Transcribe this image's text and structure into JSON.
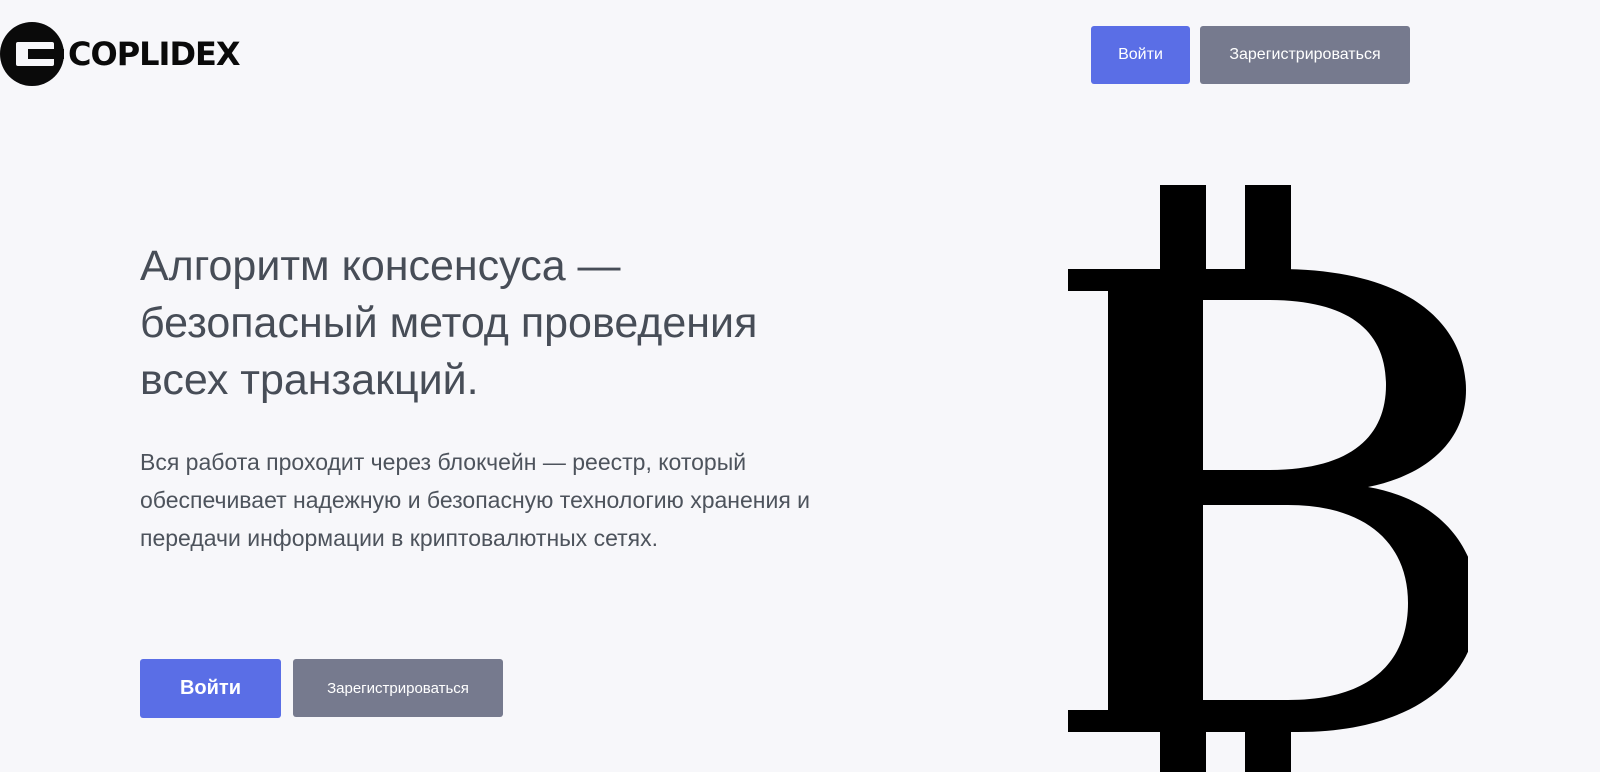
{
  "brand": {
    "name": "COPLIDEX",
    "logo_icon": "coplidex-logo-icon"
  },
  "header": {
    "login_label": "Войти",
    "signup_label": "Зарегистрироваться"
  },
  "hero": {
    "title": "Алгоритм консенсуса — безопасный метод проведения всех транзакций.",
    "text": "Вся работа проходит через блокчейн — реестр, который обеспечивает надежную и безопасную технологию хранения и передачи информации в криптовалютных сетях.",
    "login_label": "Войти",
    "signup_label": "Зарегистрироваться",
    "illustration_icon": "bitcoin-icon"
  },
  "colors": {
    "background": "#f7f7fa",
    "primary": "#5a6ee6",
    "secondary": "#767a8e",
    "heading": "#474d57",
    "text": "#4d535c",
    "logo": "#0a0a0a"
  }
}
